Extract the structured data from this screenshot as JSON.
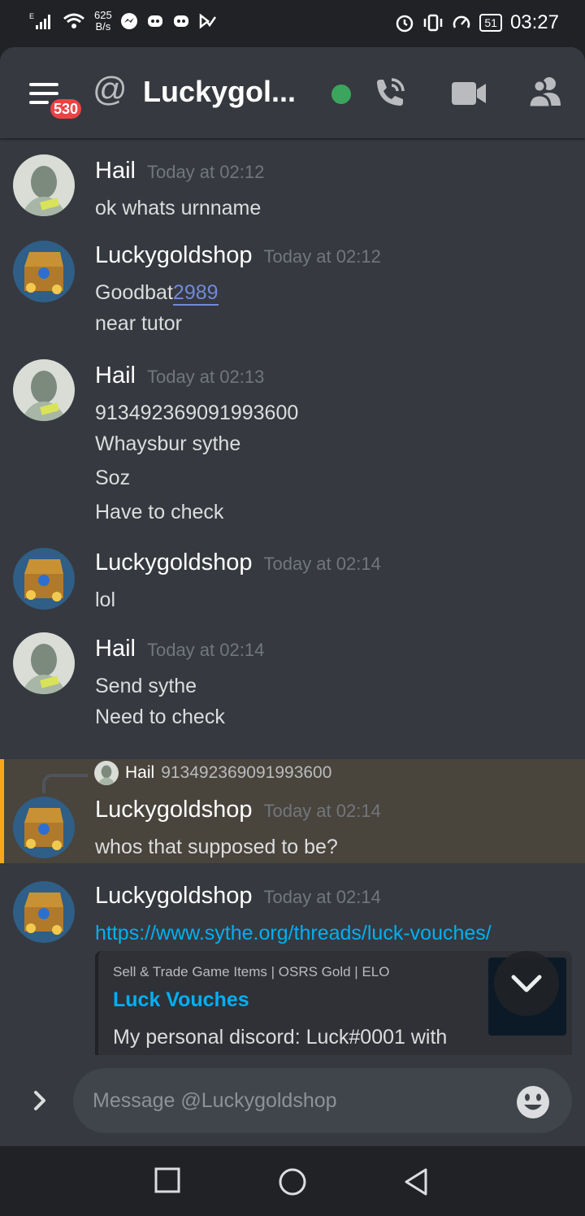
{
  "status_bar": {
    "net_speed_value": "625",
    "net_speed_unit": "B/s",
    "battery": "51",
    "time": "03:27"
  },
  "header": {
    "at_symbol": "@",
    "title": "Luckygol...",
    "notification_badge": "530"
  },
  "messages": [
    {
      "author": "Hail",
      "time": "Today at 02:12",
      "lines": [
        "ok whats urnname"
      ]
    },
    {
      "author": "Luckygoldshop",
      "time": "Today at 02:12",
      "mention_prefix": "Goodbat",
      "mention": "2989",
      "lines": [
        "near tutor"
      ]
    },
    {
      "author": "Hail",
      "time": "Today at 02:13",
      "lines": [
        "913492369091993600",
        "Whaysbur sythe",
        "Soz",
        "Have to check"
      ]
    },
    {
      "author": "Luckygoldshop",
      "time": "Today at 02:14",
      "lines": [
        "lol"
      ]
    },
    {
      "author": "Hail",
      "time": "Today at 02:14",
      "lines": [
        "Send sythe",
        "Need to check"
      ]
    },
    {
      "author": "Luckygoldshop",
      "time": "Today at 02:14",
      "lines": [
        "whos that supposed to be?"
      ],
      "reply": {
        "author": "Hail",
        "text": "913492369091993600"
      }
    },
    {
      "author": "Luckygoldshop",
      "time": "Today at 02:14",
      "link": "https://www.sythe.org/threads/luck-vouches/"
    }
  ],
  "embed": {
    "provider": "Sell & Trade Game Items | OSRS Gold | ELO",
    "title": "Luck Vouches",
    "description": "My personal discord: Luck#0001 with"
  },
  "composer": {
    "placeholder": "Message @Luckygoldshop"
  },
  "icons": {
    "menu": "hamburger-icon",
    "call": "phone-call-icon",
    "video": "video-camera-icon",
    "members": "members-icon",
    "expand": "chevron-right-icon",
    "emoji": "emoji-icon",
    "scroll": "chevron-down-icon",
    "nav_back": "triangle-back-icon",
    "nav_home": "circle-home-icon",
    "nav_recents": "square-recents-icon"
  },
  "colors": {
    "background": "#36393f",
    "accent_link": "#00b0f4",
    "online": "#3ba55d",
    "badge": "#ed4245",
    "highlight_border": "#faa61a"
  }
}
